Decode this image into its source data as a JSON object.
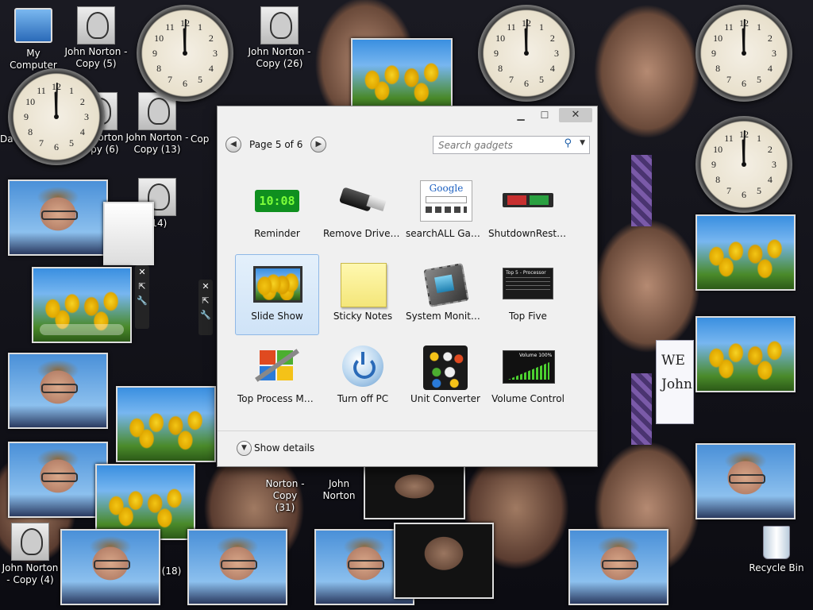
{
  "desktop": {
    "icons": [
      {
        "id": "my-computer",
        "label": "My Computer"
      },
      {
        "id": "jn5",
        "label": "John Norton - Copy (5)"
      },
      {
        "id": "jn26",
        "label": "John Norton - Copy (26)"
      },
      {
        "id": "jn6",
        "label": "John Norton - Copy (6)"
      },
      {
        "id": "jn13",
        "label": "John Norton - Copy (13)"
      },
      {
        "id": "jn14",
        "label": "(14)"
      },
      {
        "id": "jn31",
        "label": "Norton - Copy (31)"
      },
      {
        "id": "jn-partial",
        "label": "John Norton"
      },
      {
        "id": "jn4",
        "label": "John Norton - Copy (4)"
      },
      {
        "id": "jn18",
        "label": "(18)"
      },
      {
        "id": "recycle",
        "label": "Recycle Bin"
      }
    ],
    "partial_labels": {
      "da": "Da",
      "jo": "Jo",
      "copy": "Copy",
      "john": "John",
      "jn_trail": "John Norton - Co",
      "cop": "Cop",
      "jn_mid": "John Norton - Jo"
    },
    "note_text": "WE John"
  },
  "gallery": {
    "page_indicator": "Page 5 of 6",
    "search_placeholder": "Search gadgets",
    "show_details": "Show details",
    "gadgets": [
      {
        "name": "Reminder",
        "icon": "reminder-icon",
        "clock": "10:08"
      },
      {
        "name": "Remove Drive S...",
        "icon": "usb-drive-icon"
      },
      {
        "name": "searchALL Gadg...",
        "icon": "google-search-icon",
        "logo": "Google"
      },
      {
        "name": "ShutdownRestart",
        "icon": "shutdown-restart-icon"
      },
      {
        "name": "Slide Show",
        "icon": "slideshow-icon",
        "selected": true
      },
      {
        "name": "Sticky Notes",
        "icon": "sticky-note-icon"
      },
      {
        "name": "System Monitor II",
        "icon": "cpu-chip-icon"
      },
      {
        "name": "Top Five",
        "icon": "top-five-icon",
        "caption": "Top 5 - Processor"
      },
      {
        "name": "Top Process Mo...",
        "icon": "windows-tools-icon"
      },
      {
        "name": "Turn off PC",
        "icon": "power-icon"
      },
      {
        "name": "Unit Converter",
        "icon": "unit-converter-icon"
      },
      {
        "name": "Volume Control",
        "icon": "volume-bars-icon",
        "caption": "Volume 100%"
      }
    ]
  },
  "colors": {
    "accent": "#1c5ea8",
    "selection": "#cfe3f7",
    "led": "#7dff3a"
  }
}
